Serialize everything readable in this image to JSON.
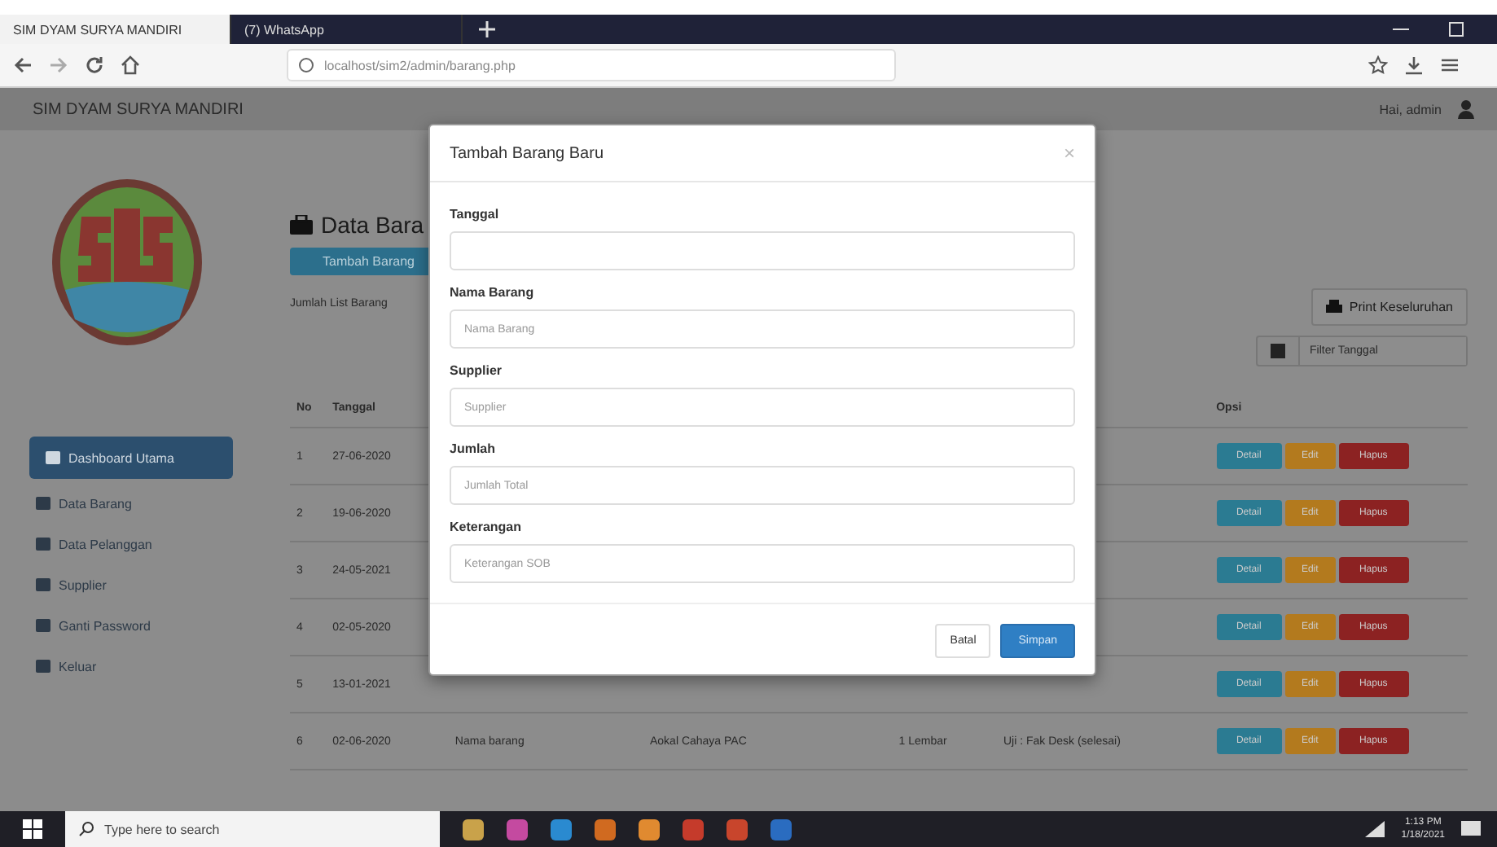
{
  "browser": {
    "tabs": [
      {
        "label": "SIM DYAM SURYA MANDIRI",
        "selected": true
      },
      {
        "label": "(7) WhatsApp",
        "selected": false
      }
    ],
    "url": "localhost/sim2/admin/barang.php"
  },
  "header": {
    "title": "SIM DYAM SURYA MANDIRI",
    "user": "Hai, admin"
  },
  "sidebar": {
    "items": [
      {
        "label": "Dashboard Utama",
        "selected": true
      },
      {
        "label": "Data Barang",
        "selected": false
      },
      {
        "label": "Data Pelanggan",
        "selected": false
      },
      {
        "label": "Supplier",
        "selected": false
      },
      {
        "label": "Ganti Password",
        "selected": false
      },
      {
        "label": "Keluar",
        "selected": false
      }
    ]
  },
  "content": {
    "title": "Data Bara",
    "add_button": "Tambah Barang",
    "count_label": "Jumlah List Barang",
    "print_button": "Print Keseluruhan",
    "filter": {
      "placeholder": "Filter Tanggal"
    }
  },
  "table": {
    "columns": [
      "No",
      "Tanggal",
      "Opsi"
    ],
    "rows": [
      {
        "no": "1",
        "date": "27-06-2020",
        "actions": [
          "Detail",
          "Edit",
          "Hapus"
        ]
      },
      {
        "no": "2",
        "date": "19-06-2020",
        "actions": [
          "Detail",
          "Edit",
          "Hapus"
        ]
      },
      {
        "no": "3",
        "date": "24-05-2021",
        "actions": [
          "Detail",
          "Edit",
          "Hapus"
        ]
      },
      {
        "no": "4",
        "date": "02-05-2020",
        "actions": [
          "Detail",
          "Edit",
          "Hapus"
        ]
      },
      {
        "no": "5",
        "date": "13-01-2021",
        "actions": [
          "Detail",
          "Edit",
          "Hapus"
        ]
      },
      {
        "no": "6",
        "date": "02-06-2020",
        "item": "Nama barang",
        "supplier": "Aokal Cahaya PAC",
        "qty": "1 Lembar",
        "note": "Uji : Fak Desk (selesai)",
        "actions": [
          "Detail",
          "Edit",
          "Hapus"
        ]
      }
    ]
  },
  "modal": {
    "title": "Tambah Barang Baru",
    "close": "×",
    "fields": [
      {
        "label": "Tanggal"
      },
      {
        "label": "Nama Barang",
        "placeholder": "Nama Barang"
      },
      {
        "label": "Supplier",
        "placeholder": "Supplier"
      },
      {
        "label": "Jumlah",
        "placeholder": "Jumlah Total"
      },
      {
        "label": "Keterangan",
        "placeholder": "Keterangan SOB"
      }
    ],
    "buttons": [
      {
        "label": "Batal",
        "kind": "secondary"
      },
      {
        "label": "Simpan",
        "kind": "primary"
      }
    ]
  },
  "taskbar": {
    "search": {
      "placeholder": "Type here to search"
    },
    "time": "1:13 PM",
    "date": "1/18/2021"
  }
}
